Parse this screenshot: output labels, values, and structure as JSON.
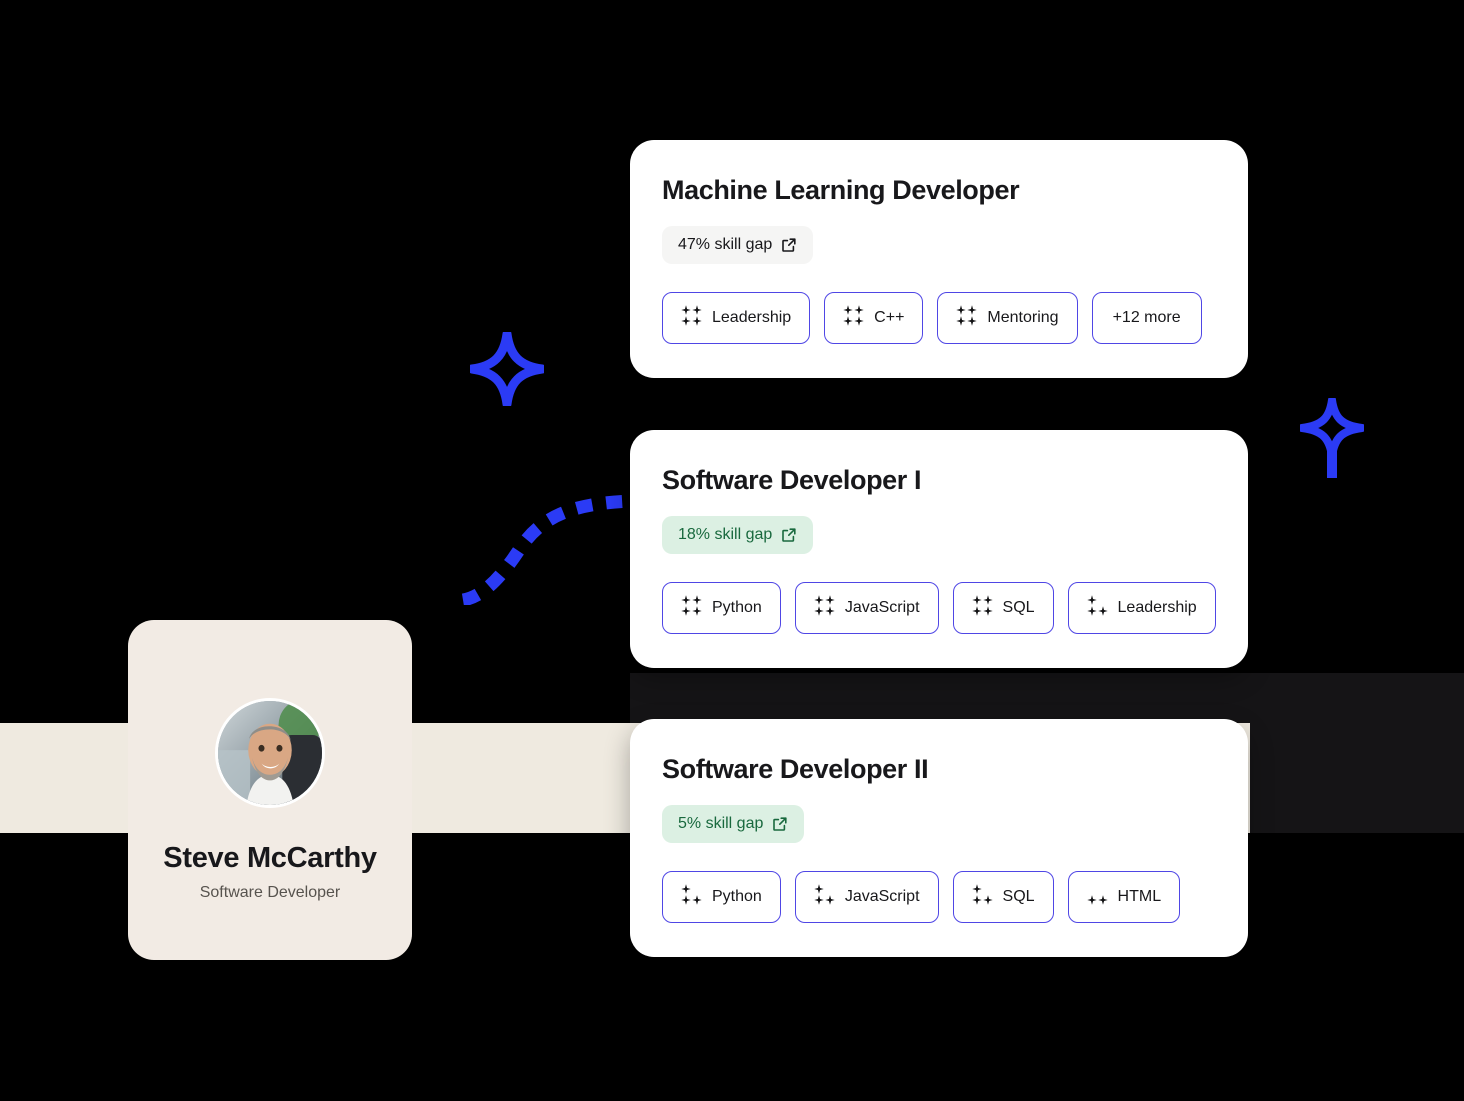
{
  "theme": {
    "background": "#000000",
    "band_color": "#EFEAE0",
    "card_background": "#FFFFFF",
    "profile_card_background": "#F2EBE4",
    "accent_blue": "#4F46E5",
    "sparkle_blue": "#2B3BF5",
    "gap_neutral_bg": "#F5F5F4",
    "gap_neutral_text": "#18181B",
    "gap_green_bg": "#DCF0E3",
    "gap_green_text": "#19693E",
    "curve_blue": "#2B3BF5"
  },
  "profile": {
    "name": "Steve McCarthy",
    "role": "Software Developer",
    "avatar_alt": "Steve McCarthy headshot"
  },
  "decorations": {
    "sparkle_left": "sparkle-icon",
    "sparkle_right": "sparkle-icon",
    "growth_curve": "dashed-growth-curve"
  },
  "roles": [
    {
      "title": "Machine Learning Developer",
      "gap_label": "47% skill gap",
      "gap_style": "neutral",
      "link_icon": "external-link-icon",
      "skills": [
        {
          "label": "Leadership",
          "level": 4
        },
        {
          "label": "C++",
          "level": 4
        },
        {
          "label": "Mentoring",
          "level": 4
        }
      ],
      "more_label": "+12 more"
    },
    {
      "title": "Software Developer I",
      "gap_label": "18% skill gap",
      "gap_style": "green",
      "link_icon": "external-link-icon",
      "skills": [
        {
          "label": "Python",
          "level": 4
        },
        {
          "label": "JavaScript",
          "level": 4
        },
        {
          "label": "SQL",
          "level": 4
        },
        {
          "label": "Leadership",
          "level": 3
        }
      ],
      "more_label": ""
    },
    {
      "title": "Software Developer II",
      "gap_label": "5% skill gap",
      "gap_style": "green",
      "link_icon": "external-link-icon",
      "skills": [
        {
          "label": "Python",
          "level": 3
        },
        {
          "label": "JavaScript",
          "level": 3
        },
        {
          "label": "SQL",
          "level": 3
        },
        {
          "label": "HTML",
          "level": 2
        }
      ],
      "more_label": ""
    }
  ]
}
